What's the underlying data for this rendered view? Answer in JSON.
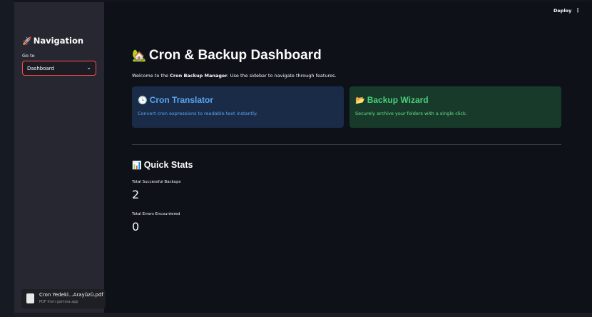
{
  "sidebar": {
    "title_emoji": "🚀",
    "title": "Navigation",
    "goto_label": "Go to",
    "select_value": "Dashboard",
    "chevron": "⌄"
  },
  "header": {
    "deploy_label": "Deploy",
    "menu_icon": "⋮"
  },
  "main": {
    "title_emoji": "🏡",
    "title": "Cron & Backup Dashboard",
    "welcome_prefix": "Welcome to the ",
    "welcome_bold": "Cron Backup Manager",
    "welcome_suffix": ". Use the sidebar to navigate through features.",
    "cards": [
      {
        "emoji": "🕒",
        "title": "Cron Translator",
        "description": "Convert cron expressions to readable text instantly."
      },
      {
        "emoji": "📂",
        "title": "Backup Wizard",
        "description": "Securely archive your folders with a single click."
      }
    ],
    "stats_emoji": "📊",
    "stats_title": "Quick Stats",
    "metrics": [
      {
        "label": "Total Successful Backups",
        "value": "2"
      },
      {
        "label": "Total Errors Encountered",
        "value": "0"
      }
    ]
  },
  "toast": {
    "filename": "Cron Yedekl...Arayüzü.pdf",
    "subtitle": "PDF from gamma.app"
  },
  "colors": {
    "accent_red": "#ff4b4b",
    "info_blue": "#5aa7f0",
    "success_green": "#4bd07a"
  }
}
